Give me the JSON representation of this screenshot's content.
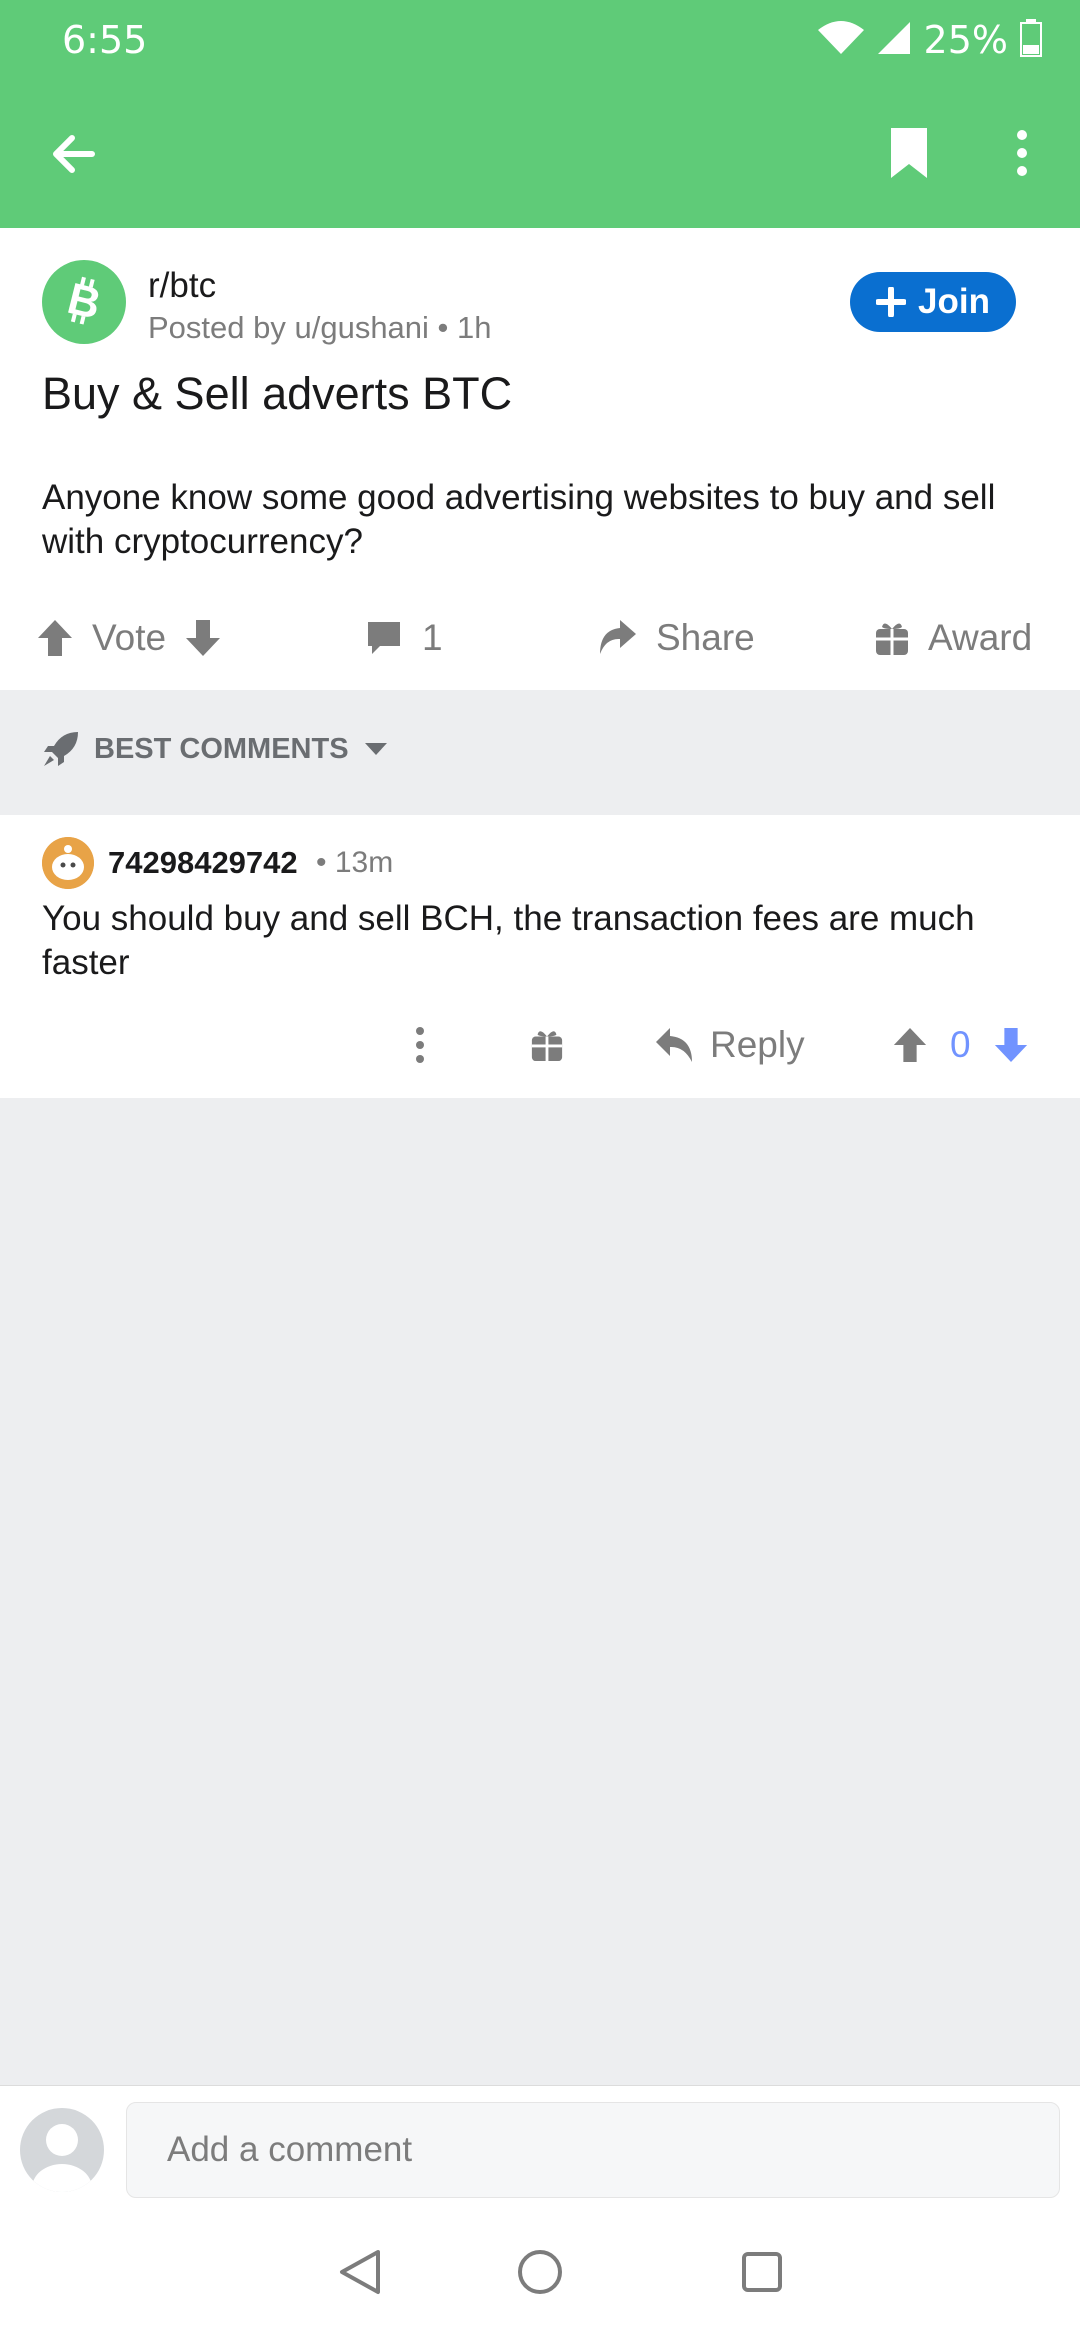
{
  "status_bar": {
    "time": "6:55",
    "battery": "25%",
    "icons": [
      "wifi-icon",
      "signal-icon",
      "battery-icon"
    ]
  },
  "toolbar": {
    "icons": [
      "back-arrow-icon",
      "bookmark-icon",
      "more-vertical-icon"
    ]
  },
  "post": {
    "subreddit": "r/btc",
    "meta": "Posted by u/gushani • 1h",
    "join_label": "Join",
    "title": "Buy & Sell adverts BTC",
    "body": "Anyone know some good advertising websites to buy and sell with cryptocurrency?",
    "actions": {
      "vote_label": "Vote",
      "comments_count": "1",
      "share_label": "Share",
      "award_label": "Award"
    }
  },
  "sort": {
    "label": "BEST COMMENTS"
  },
  "comment": {
    "author": "74298429742",
    "time": "• 13m",
    "body": "You should buy and sell BCH, the transaction fees are much faster",
    "reply_label": "Reply",
    "score": "0"
  },
  "composer": {
    "placeholder": "Add a comment"
  },
  "colors": {
    "header": "#5fcb78",
    "join_button": "#0a6fd0",
    "downvote_active": "#7193ff",
    "page_bg": "#edeef0"
  }
}
